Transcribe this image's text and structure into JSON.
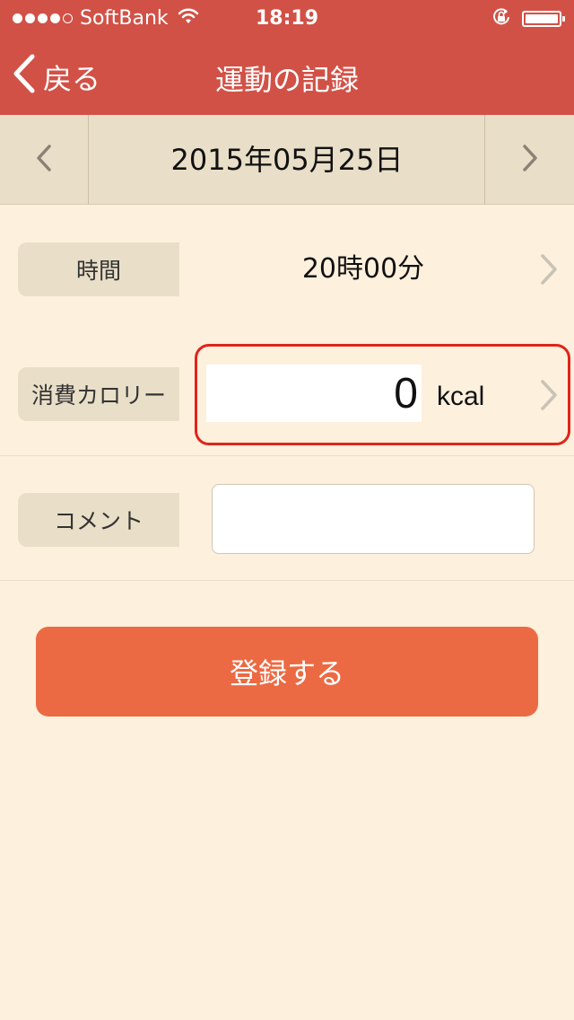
{
  "status": {
    "carrier": "SoftBank",
    "time": "18:19",
    "signal_bars": 4,
    "signal_total": 5
  },
  "nav": {
    "back_label": "戻る",
    "title": "運動の記録"
  },
  "date": {
    "label": "2015年05月25日"
  },
  "time_row": {
    "label": "時間",
    "value": "20時00分"
  },
  "calorie_row": {
    "label": "消費カロリー",
    "value": "0",
    "unit": "kcal"
  },
  "comment_row": {
    "label": "コメント",
    "value": "",
    "placeholder": ""
  },
  "submit": {
    "label": "登録する"
  },
  "colors": {
    "header": "#d25146",
    "background": "#fdf0dc",
    "label_bg": "#e9dec7",
    "button": "#ec6a43",
    "highlight": "#e2231a"
  },
  "icons": [
    "wifi-icon",
    "rotation-lock-icon",
    "battery-icon",
    "back-chevron-icon",
    "chevron-left-icon",
    "chevron-right-icon"
  ]
}
